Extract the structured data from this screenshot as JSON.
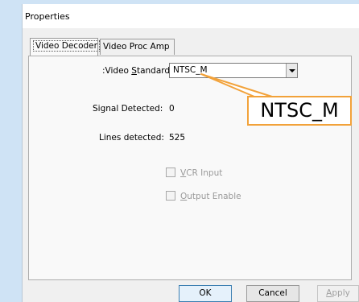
{
  "window": {
    "title": "Properties"
  },
  "tabs": [
    {
      "label": "Video Decoder",
      "active": true
    },
    {
      "label": "Video Proc Amp",
      "active": false
    }
  ],
  "video_standard": {
    "label_prefix": ":Video ",
    "label_underlined": "S",
    "label_suffix": "tandard",
    "selected": "NTSC_M"
  },
  "signal_detected": {
    "label": "Signal Detected:",
    "value": "0"
  },
  "lines_detected": {
    "label": "Lines detected:",
    "value": "525"
  },
  "checkboxes": [
    {
      "underlined": "V",
      "rest": "CR Input",
      "checked": false,
      "enabled": false
    },
    {
      "underlined": "O",
      "rest": "utput Enable",
      "checked": false,
      "enabled": false
    }
  ],
  "buttons": {
    "ok": "OK",
    "cancel": "Cancel",
    "apply_underlined": "A",
    "apply_rest": "pply"
  },
  "callout": {
    "text": "NTSC_M",
    "color": "#f2a23a"
  }
}
